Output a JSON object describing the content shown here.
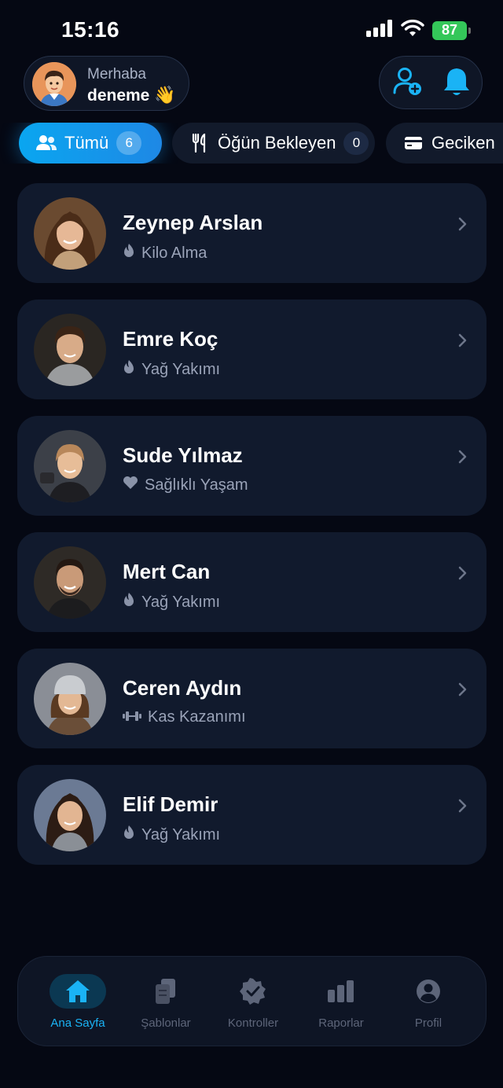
{
  "status_bar": {
    "time": "15:16",
    "battery": "87"
  },
  "header": {
    "greeting": "Merhaba",
    "username": "deneme",
    "wave_emoji": "👋",
    "add_client_icon": "person-add-icon",
    "notifications_icon": "bell-icon"
  },
  "filters": [
    {
      "label": "Tümü",
      "count": "6",
      "icon": "users-icon",
      "active": true
    },
    {
      "label": "Öğün Bekleyen",
      "count": "0",
      "icon": "fork-knife-icon",
      "active": false
    },
    {
      "label": "Geciken",
      "count": "0",
      "icon": "card-icon",
      "active": false
    }
  ],
  "clients": [
    {
      "name": "Zeynep Arslan",
      "goal": "Kilo Alma",
      "goal_icon": "flame-icon"
    },
    {
      "name": "Emre Koç",
      "goal": "Yağ Yakımı",
      "goal_icon": "flame-icon"
    },
    {
      "name": "Sude Yılmaz",
      "goal": "Sağlıklı Yaşam",
      "goal_icon": "heart-icon"
    },
    {
      "name": "Mert Can",
      "goal": "Yağ Yakımı",
      "goal_icon": "flame-icon"
    },
    {
      "name": "Ceren Aydın",
      "goal": "Kas Kazanımı",
      "goal_icon": "dumbbell-icon"
    },
    {
      "name": "Elif Demir",
      "goal": "Yağ Yakımı",
      "goal_icon": "flame-icon"
    }
  ],
  "bottom_nav": [
    {
      "label": "Ana Sayfa",
      "icon": "home-icon",
      "active": true
    },
    {
      "label": "Şablonlar",
      "icon": "documents-icon",
      "active": false
    },
    {
      "label": "Kontroller",
      "icon": "verified-badge-icon",
      "active": false
    },
    {
      "label": "Raporlar",
      "icon": "bar-chart-icon",
      "active": false
    },
    {
      "label": "Profil",
      "icon": "profile-icon",
      "active": false
    }
  ],
  "colors": {
    "background": "#050813",
    "card": "#111a2d",
    "accent": "#1ab3f5",
    "muted_text": "#9aa3b8"
  }
}
